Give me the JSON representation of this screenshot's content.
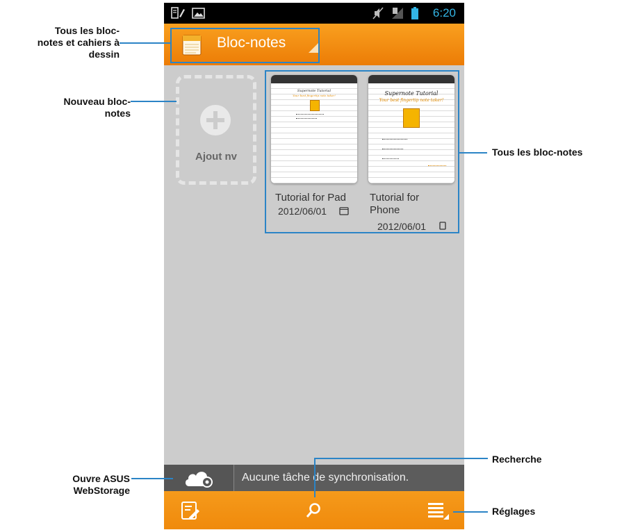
{
  "status_bar": {
    "time": "6:20"
  },
  "action_bar": {
    "title": "Bloc-notes"
  },
  "new_notebook": {
    "label": "Ajout nv"
  },
  "notebooks": [
    {
      "cover_title": "Supernote Tutorial",
      "cover_subtitle": "Your best fingertip note taker!",
      "name": "Tutorial for Pad",
      "date": "2012/06/01",
      "device_icon": "tablet-icon"
    },
    {
      "cover_title": "Supernote Tutorial",
      "cover_subtitle": "Your best fingertip note taker!",
      "name_line1": "Tutorial for",
      "name_line2": "Phone",
      "date": "2012/06/01",
      "device_icon": "phone-icon"
    }
  ],
  "sync_bar": {
    "message": "Aucune tâche de synchronisation."
  },
  "annotations": {
    "all_notebooks_sketchbooks": [
      "Tous les bloc-",
      "notes et cahiers à",
      "dessin"
    ],
    "new_notebook": [
      "Nouveau bloc-",
      "notes"
    ],
    "all_notebooks": "Tous les bloc-notes",
    "search": "Recherche",
    "webstorage": [
      "Ouvre ASUS",
      "WebStorage"
    ],
    "settings": "Réglages"
  },
  "colors": {
    "accent_orange": "#f08a0c",
    "status_blue": "#33b5e5",
    "annotation_blue": "#2b84c6"
  }
}
